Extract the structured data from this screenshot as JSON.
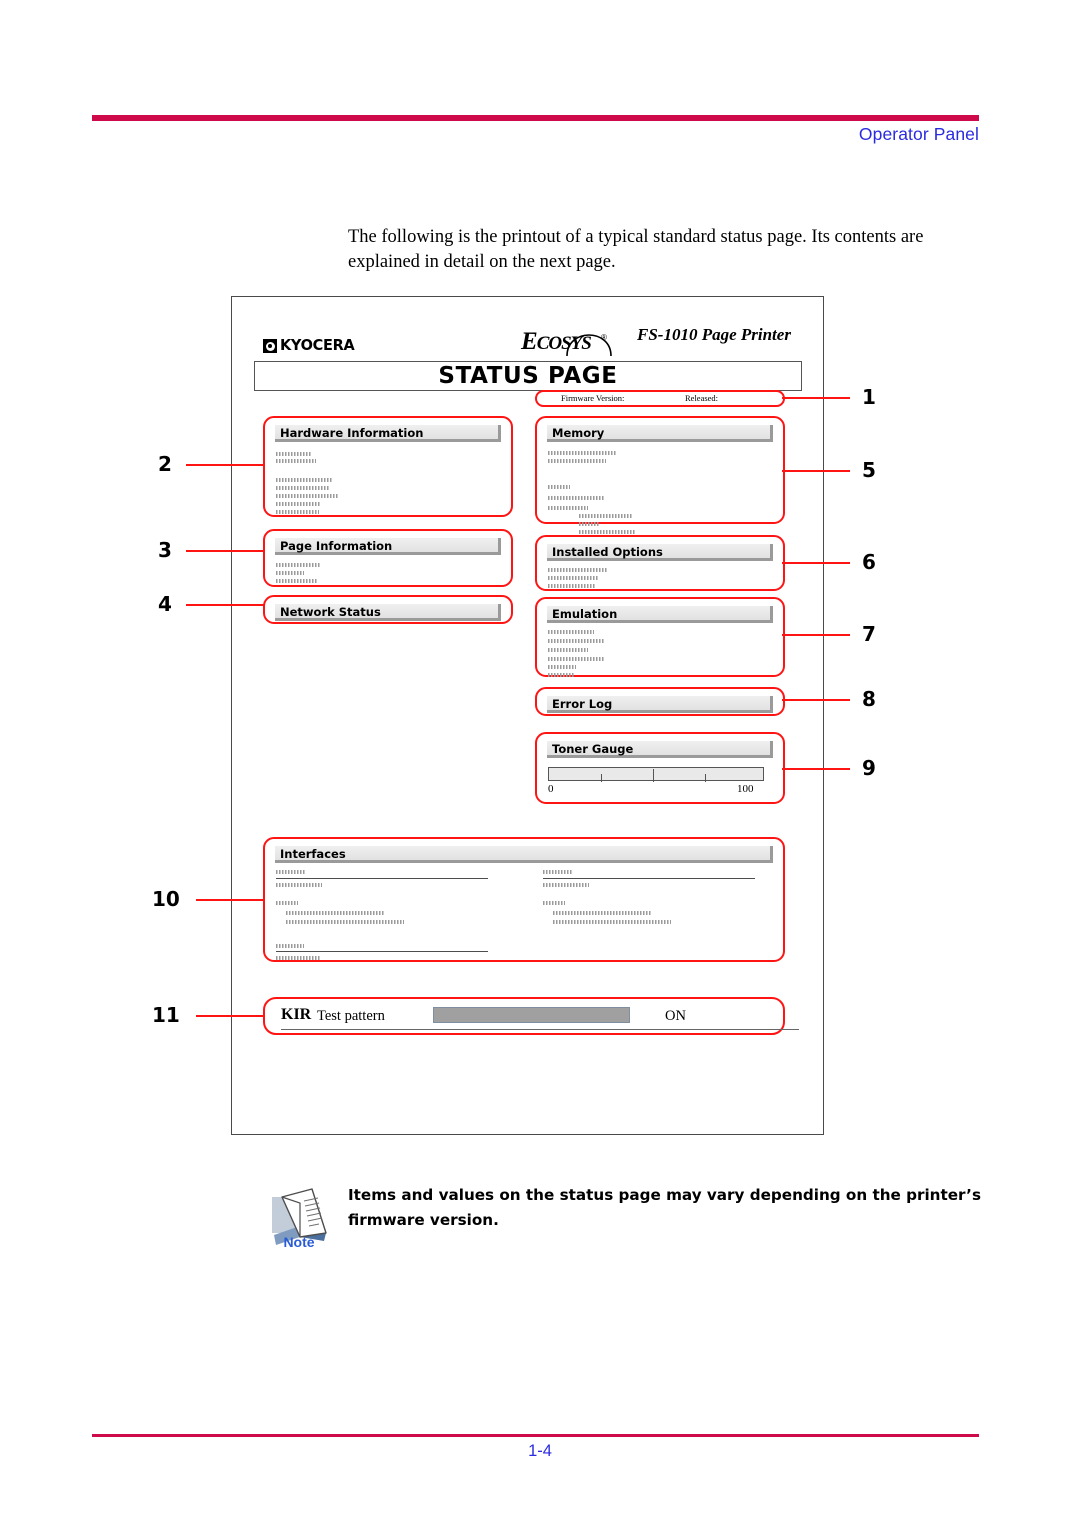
{
  "header": {
    "section_title": "Operator Panel"
  },
  "footer": {
    "page_number": "1-4"
  },
  "intro": {
    "paragraph": "The following is the printout of a typical standard status page. Its contents are explained in detail on the next page."
  },
  "status_page": {
    "brand": "KYOCERA",
    "product_line": "Ecosys",
    "product_line_small": "COSYS",
    "product_line_lead": "E",
    "registered_mark": "®",
    "model": "FS-1010  Page Printer",
    "banner_title": "STATUS PAGE",
    "firmware_label": "Firmware Version:",
    "released_label": "Released:",
    "sections": {
      "hardware_information": "Hardware Information",
      "page_information": "Page Information",
      "network_status": "Network Status",
      "memory": "Memory",
      "installed_options": "Installed Options",
      "emulation": "Emulation",
      "error_log": "Error Log",
      "toner_gauge": "Toner Gauge",
      "interfaces": "Interfaces"
    },
    "toner_gauge": {
      "min_label": "0",
      "max_label": "100"
    },
    "kir": {
      "label": "KIR",
      "test_pattern_label": "Test pattern",
      "state": "ON"
    }
  },
  "callouts": [
    {
      "id": "1",
      "number": "1"
    },
    {
      "id": "2",
      "number": "2"
    },
    {
      "id": "3",
      "number": "3"
    },
    {
      "id": "4",
      "number": "4"
    },
    {
      "id": "5",
      "number": "5"
    },
    {
      "id": "6",
      "number": "6"
    },
    {
      "id": "7",
      "number": "7"
    },
    {
      "id": "8",
      "number": "8"
    },
    {
      "id": "9",
      "number": "9"
    },
    {
      "id": "10",
      "number": "10"
    },
    {
      "id": "11",
      "number": "11"
    }
  ],
  "note": {
    "label": "Note",
    "text": "Items and values on the status page may vary depending on the printer’s firmware version."
  },
  "colors": {
    "rule_red": "#cf0a4b",
    "callout_red": "#ff1414",
    "link_blue": "#2a2ae0",
    "note_blue": "#2a5bd7"
  }
}
